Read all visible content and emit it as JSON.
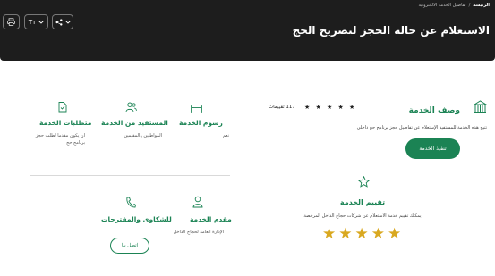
{
  "header": {
    "breadcrumb": {
      "home": "الرئيسة",
      "separator": "/",
      "current": "تفاصيل الخدمة الالكترونية"
    },
    "title": "الاستعلام عن حالة الحجز لتصريح الحج",
    "tools": {
      "font_size": "Tт",
      "share_icon": "share-icon",
      "font_icon": "text-size-icon",
      "print_icon": "print-icon"
    }
  },
  "service_description": {
    "title": "وصف الخدمة",
    "stars": "★ ★ ★ ★ ★",
    "rating_count": "117 تقييمات",
    "description": "تتيح هذه الخدمة للمستفيد الإستعلام عن تفاصيل حجز برنامج حج داخلي",
    "execute_button": "تنفيذ الخدمة"
  },
  "info": {
    "fees": {
      "title": "رسوم الخدمة",
      "desc": "نعم"
    },
    "beneficiary": {
      "title": "المستفيد من الخدمة",
      "desc": "المواطنين والمقيمين"
    },
    "requirements": {
      "title": "متطلبات الخدمة",
      "desc": "ان يكون مقدما لطلب حجز برنامج حج"
    },
    "provider": {
      "title": "مقدم الخدمة",
      "desc": "الإدارة العامة لحجاج الداخل"
    },
    "complaints": {
      "title": "للشكاوى والمقترحات",
      "button": "اتصل بنا"
    }
  },
  "rating": {
    "title": "تقييم الخدمة",
    "description": "يمكنك تقييم خدمة الاستعلام عن شركات حجاج الداخل المرخصة",
    "star": "★"
  },
  "colors": {
    "accent": "#1b8354",
    "header_bg": "#1d1d1d",
    "star": "#d9a820"
  }
}
